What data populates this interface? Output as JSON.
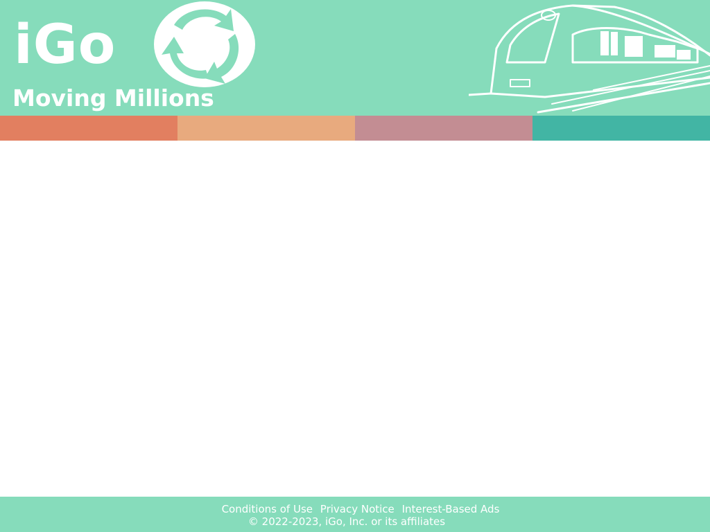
{
  "header": {
    "brand": "iGo",
    "tagline": "Moving Millions",
    "background_color": "#86dcbb",
    "emblem_icon": "circular-arrows-icon",
    "illustration_icon": "high-speed-train-icon"
  },
  "color_band": {
    "colors": [
      "#e27f60",
      "#e8aa7e",
      "#c38d93",
      "#42b5a4"
    ]
  },
  "footer": {
    "background_color": "#86dcbb",
    "links": [
      "Conditions of Use",
      "Privacy Notice",
      "Interest-Based Ads"
    ],
    "copyright": "© 2022-2023, iGo, Inc. or its affiliates"
  }
}
